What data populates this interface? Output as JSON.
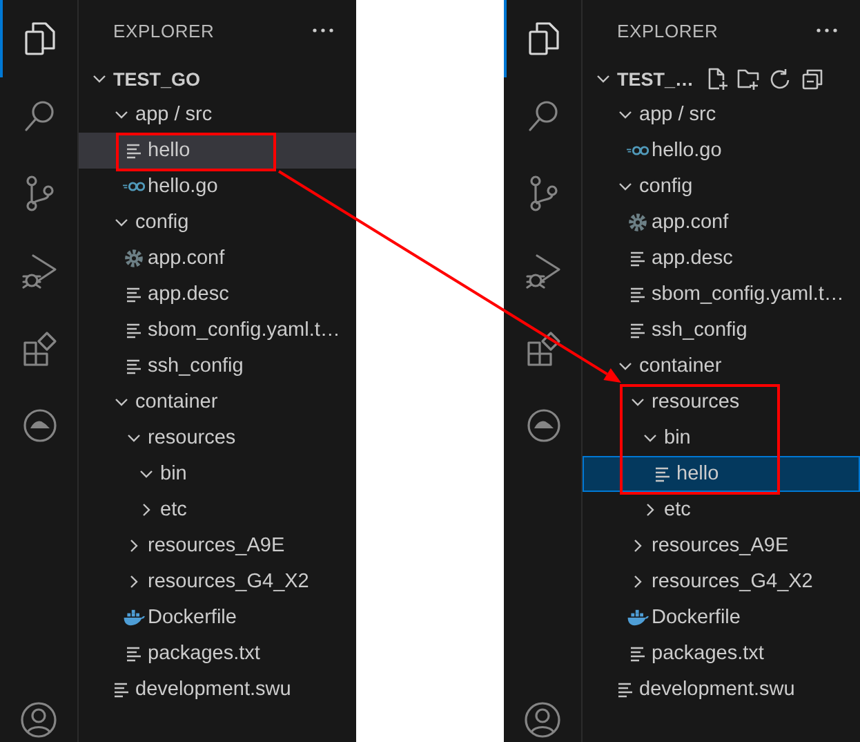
{
  "arrow": true,
  "panels": [
    {
      "focused": false,
      "activity_bar": {
        "items": [
          {
            "kind": "explorer",
            "selected": true
          },
          {
            "kind": "search",
            "selected": false
          },
          {
            "kind": "source_control",
            "selected": false
          },
          {
            "kind": "run_debug",
            "selected": false
          },
          {
            "kind": "extensions",
            "selected": false
          },
          {
            "kind": "remote",
            "selected": false
          }
        ]
      },
      "sidebar": {
        "title": "EXPLORER"
      },
      "tree": {
        "label": "TEST_GO",
        "expanded": true,
        "actions_visible": false,
        "children": [
          {
            "label": "app / src",
            "kind": "folder",
            "expanded": true,
            "selected": false,
            "children": [
              {
                "label": "hello",
                "kind": "text_file",
                "selected": true,
                "boxed": true
              },
              {
                "label": "hello.go",
                "kind": "go_file",
                "selected": false
              }
            ]
          },
          {
            "label": "config",
            "kind": "folder",
            "expanded": true,
            "selected": false,
            "children": [
              {
                "label": "app.conf",
                "kind": "settings_file",
                "selected": false
              },
              {
                "label": "app.desc",
                "kind": "text_file",
                "selected": false
              },
              {
                "label": "sbom_config.yaml.t…",
                "kind": "text_file",
                "selected": false
              },
              {
                "label": "ssh_config",
                "kind": "text_file",
                "selected": false
              }
            ]
          },
          {
            "label": "container",
            "kind": "folder",
            "expanded": true,
            "selected": false,
            "children": [
              {
                "label": "resources",
                "kind": "folder",
                "expanded": true,
                "selected": false,
                "children": [
                  {
                    "label": "bin",
                    "kind": "folder",
                    "expanded": true,
                    "selected": false
                  },
                  {
                    "label": "etc",
                    "kind": "folder",
                    "expanded": false,
                    "selected": false
                  }
                ]
              },
              {
                "label": "resources_A9E",
                "kind": "folder",
                "expanded": false,
                "selected": false
              },
              {
                "label": "resources_G4_X2",
                "kind": "folder",
                "expanded": false,
                "selected": false
              },
              {
                "label": "Dockerfile",
                "kind": "docker_file",
                "selected": false
              },
              {
                "label": "packages.txt",
                "kind": "text_file",
                "selected": false
              }
            ]
          },
          {
            "label": "development.swu",
            "kind": "text_file",
            "selected": false
          }
        ]
      }
    },
    {
      "focused": true,
      "activity_bar": {
        "items": [
          {
            "kind": "explorer",
            "selected": true
          },
          {
            "kind": "search",
            "selected": false
          },
          {
            "kind": "source_control",
            "selected": false
          },
          {
            "kind": "run_debug",
            "selected": false
          },
          {
            "kind": "extensions",
            "selected": false
          },
          {
            "kind": "remote",
            "selected": false
          }
        ]
      },
      "sidebar": {
        "title": "EXPLORER"
      },
      "tree": {
        "label": "TEST_…",
        "expanded": true,
        "actions_visible": true,
        "children": [
          {
            "label": "app / src",
            "kind": "folder",
            "expanded": true,
            "selected": false,
            "children": [
              {
                "label": "hello.go",
                "kind": "go_file",
                "selected": false
              }
            ]
          },
          {
            "label": "config",
            "kind": "folder",
            "expanded": true,
            "selected": false,
            "children": [
              {
                "label": "app.conf",
                "kind": "settings_file",
                "selected": false
              },
              {
                "label": "app.desc",
                "kind": "text_file",
                "selected": false
              },
              {
                "label": "sbom_config.yaml.t…",
                "kind": "text_file",
                "selected": false
              },
              {
                "label": "ssh_config",
                "kind": "text_file",
                "selected": false
              }
            ]
          },
          {
            "label": "container",
            "kind": "folder",
            "expanded": true,
            "selected": false,
            "children": [
              {
                "label": "resources",
                "kind": "folder",
                "expanded": true,
                "selected": false,
                "boxed": true,
                "children": [
                  {
                    "label": "bin",
                    "kind": "folder",
                    "expanded": true,
                    "selected": false,
                    "boxed": true,
                    "children": [
                      {
                        "label": "hello",
                        "kind": "text_file",
                        "selected": true,
                        "boxed": true
                      }
                    ]
                  },
                  {
                    "label": "etc",
                    "kind": "folder",
                    "expanded": false,
                    "selected": false
                  }
                ]
              },
              {
                "label": "resources_A9E",
                "kind": "folder",
                "expanded": false,
                "selected": false
              },
              {
                "label": "resources_G4_X2",
                "kind": "folder",
                "expanded": false,
                "selected": false
              },
              {
                "label": "Dockerfile",
                "kind": "docker_file",
                "selected": false
              },
              {
                "label": "packages.txt",
                "kind": "text_file",
                "selected": false
              }
            ]
          },
          {
            "label": "development.swu",
            "kind": "text_file",
            "selected": false
          }
        ]
      }
    }
  ]
}
